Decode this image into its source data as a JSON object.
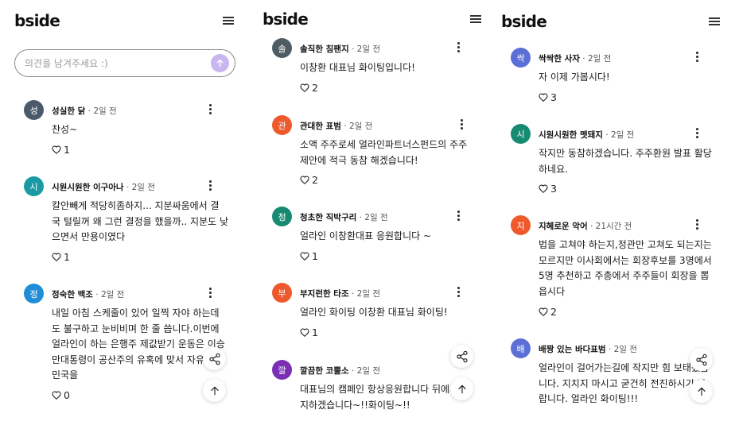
{
  "app": {
    "logo": "bside",
    "input_placeholder": "의견을 남겨주세요 :)"
  },
  "panels": [
    {
      "comments": [
        {
          "avatar_char": "성",
          "avatar_color": "#4b5a6b",
          "name": "성실한 닭",
          "time": "2일 전",
          "lines": [
            "찬성~"
          ],
          "likes": "1"
        },
        {
          "avatar_char": "시",
          "avatar_color": "#1a9aa3",
          "name": "시원시원한 이구아나",
          "time": "2일 전",
          "lines": [
            "칼안빼게 적당히좀하지... 지분싸움에서 결",
            "국 털릴꺼 왜 그런 결정을 했을까.. 지분도 낮",
            "으면서 만용이였다"
          ],
          "likes": "1"
        },
        {
          "avatar_char": "정",
          "avatar_color": "#1f8ed6",
          "name": "정숙한 백조",
          "time": "2일 전",
          "lines": [
            "내일 아침 스케줄이 있어 일찍 자야 하는데",
            "도 불구하고 눈비비며 한 줄 씁니다.이번에",
            "얼라인이 하는 은행주 제값받기 운동은 이승",
            "만대통령이 공산주의 유혹에 맞서 자유",
            "민국을"
          ],
          "likes": "0"
        }
      ]
    },
    {
      "comments": [
        {
          "avatar_char": "솔",
          "avatar_color": "#4f5b63",
          "name": "솔직한 침팬지",
          "time": "2일 전",
          "lines": [
            "이창환 대표님 화이팅입니다!"
          ],
          "likes": "2"
        },
        {
          "avatar_char": "관",
          "avatar_color": "#ee5a2c",
          "name": "관대한 표범",
          "time": "2일 전",
          "lines": [
            "소액 주주로세 얼라인파트너스펀드의 주주",
            "제안에 적극 동참 해겠습니다!"
          ],
          "likes": "2"
        },
        {
          "avatar_char": "청",
          "avatar_color": "#178a72",
          "name": "청초한 직박구리",
          "time": "2일 전",
          "lines": [
            "얼라인 이창환대표 응원합니다 ~"
          ],
          "likes": "1"
        },
        {
          "avatar_char": "부",
          "avatar_color": "#ee5a2c",
          "name": "부지런한 타조",
          "time": "2일 전",
          "lines": [
            "얼라인 화이팅 이창환 대표님 화이팅!"
          ],
          "likes": "1"
        },
        {
          "avatar_char": "깔",
          "avatar_color": "#7a2fb5",
          "name": "깔끔한 코뿔소",
          "time": "2일 전",
          "lines": [
            "대표님의 캠페인 항상응원합니다 뒤에서",
            "지하겠습니다~!!화이팅~!!"
          ],
          "likes": ""
        }
      ]
    },
    {
      "comments": [
        {
          "avatar_char": "싹",
          "avatar_color": "#5b6fd6",
          "name": "싹싹한 사자",
          "time": "2일 전",
          "lines": [
            "자 이제 가봅시다!"
          ],
          "likes": "3"
        },
        {
          "avatar_char": "시",
          "avatar_color": "#178a72",
          "name": "시원시원한 멧돼지",
          "time": "2일 전",
          "lines": [
            "작지만 동참하겠습니다. 주주환원 발표 활당",
            "하네요."
          ],
          "likes": "3"
        },
        {
          "avatar_char": "지",
          "avatar_color": "#ee5a2c",
          "name": "지혜로운 악어",
          "time": "21시간 전",
          "lines": [
            "법을 고쳐야 하는지,정관만 고쳐도 되는지는",
            "모르지만 이사회에서는 회장후보를 3명에서",
            "5명 추천하고 주총에서 주주들이 회장을 뽑",
            "읍시다"
          ],
          "likes": "2"
        },
        {
          "avatar_char": "배",
          "avatar_color": "#5b6fd6",
          "name": "배짱 있는 바다표범",
          "time": "2일 전",
          "lines": [
            "얼라인이 걸어가는길에 작지만 힘 보태겠습",
            "니다. 지치지 마시고 굳건히 전진하시기 바",
            "랍니다. 얼라인 화이팅!!!"
          ],
          "likes": ""
        }
      ]
    }
  ]
}
